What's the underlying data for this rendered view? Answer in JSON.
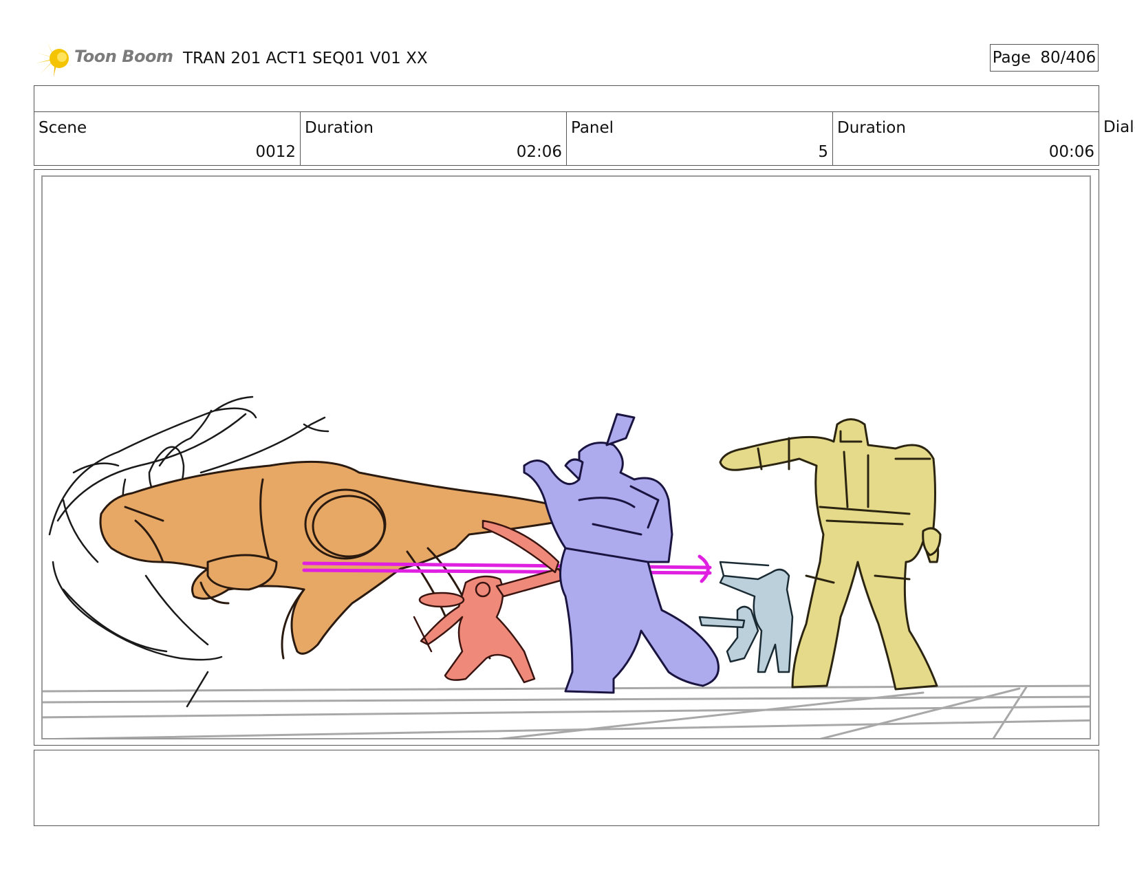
{
  "header": {
    "logo_text": "Toon Boom",
    "title": "TRAN 201 ACT1 SEQ01 V01 XX",
    "page_label": "Page",
    "page_number": "80/406"
  },
  "info": {
    "scene_label": "Scene",
    "scene_value": "0012",
    "scene_duration_label": "Duration",
    "scene_duration_value": "02:06",
    "panel_label": "Panel",
    "panel_value": "5",
    "panel_duration_label": "Duration",
    "panel_duration_value": "00:06",
    "dialog_label": "Dialog"
  },
  "colors": {
    "logo_yellow": "#f5c400",
    "beast_orange": "#e8a865",
    "red_robot": "#ef8a7a",
    "purple_robot": "#aeaaee",
    "blue_soldier": "#bcd0dc",
    "yellow_robot": "#e5d98a",
    "laser_magenta": "#e020e0",
    "floor_grid": "#a8a8a8"
  },
  "icons": [
    "toon-boom-logo-icon"
  ]
}
